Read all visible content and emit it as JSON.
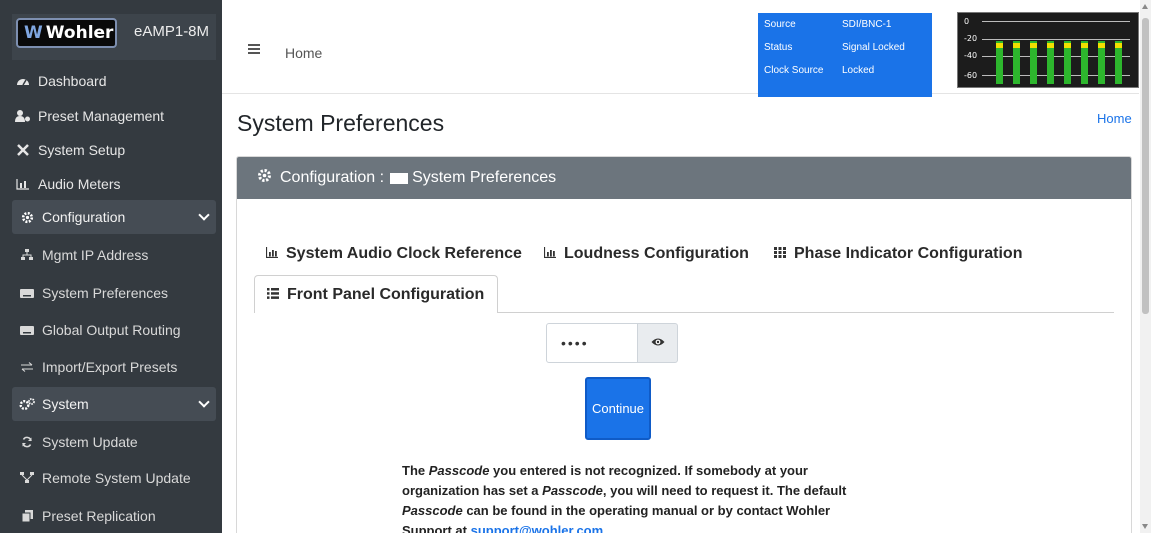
{
  "brand": {
    "logo": "Wohler",
    "model": "eAMP1-8M"
  },
  "sidebar": {
    "items": [
      {
        "label": "Dashboard",
        "icon": "tachometer-icon"
      },
      {
        "label": "Preset Management",
        "icon": "user-cog-icon"
      },
      {
        "label": "System Setup",
        "icon": "tools-icon"
      },
      {
        "label": "Audio Meters",
        "icon": "chart-bar-icon"
      },
      {
        "label": "Configuration",
        "icon": "gear-icon"
      },
      {
        "label": "Mgmt IP Address",
        "icon": "network-icon"
      },
      {
        "label": "System Preferences",
        "icon": "keyboard-icon"
      },
      {
        "label": "Global Output Routing",
        "icon": "keyboard-icon"
      },
      {
        "label": "Import/Export Presets",
        "icon": "exchange-icon"
      },
      {
        "label": "System",
        "icon": "gears-icon"
      },
      {
        "label": "System Update",
        "icon": "sync-icon"
      },
      {
        "label": "Remote System Update",
        "icon": "satellite-dish-icon"
      },
      {
        "label": "Preset Replication",
        "icon": "copy-icon"
      }
    ]
  },
  "header": {
    "home": "Home"
  },
  "status": {
    "rows": [
      {
        "key": "Source",
        "value": "SDI/BNC-1"
      },
      {
        "key": "Status",
        "value": "Signal Locked"
      },
      {
        "key": "Clock Source",
        "value": "Locked"
      }
    ]
  },
  "meter": {
    "labels": [
      "0",
      "-20",
      "-40",
      "-60"
    ],
    "levels": [
      0.93,
      0.93,
      0.93,
      0.93,
      0.93,
      0.93,
      0.93,
      0.93
    ]
  },
  "page": {
    "title": "System Preferences",
    "breadcrumb": "Home"
  },
  "card": {
    "prefix": "Configuration :",
    "title": "System Preferences"
  },
  "tabs": [
    {
      "label": "System Audio Clock Reference",
      "icon": "chart-icon"
    },
    {
      "label": "Loudness Configuration",
      "icon": "chart-icon"
    },
    {
      "label": "Phase Indicator Configuration",
      "icon": "grid-icon"
    },
    {
      "label": "Front Panel Configuration",
      "icon": "list-icon",
      "active": true
    }
  ],
  "form": {
    "passcode_value": "••••",
    "continue_label": "Continue"
  },
  "message": {
    "t1": "The ",
    "em1": "Passcode",
    "t2": " you entered is not recognized. If somebody at your organization has set a ",
    "em2": "Passcode",
    "t3": ", you will need to request it. The default ",
    "em3": "Passcode",
    "t4": " can be found in the operating manual or by contact Wohler Support at ",
    "link": "support@wohler.com"
  },
  "colors": {
    "sidebar": "#343a40",
    "accent": "#1a73e8",
    "card_header": "#6c757d",
    "meter_green": "#2db62d",
    "meter_yellow": "#f2e000"
  }
}
